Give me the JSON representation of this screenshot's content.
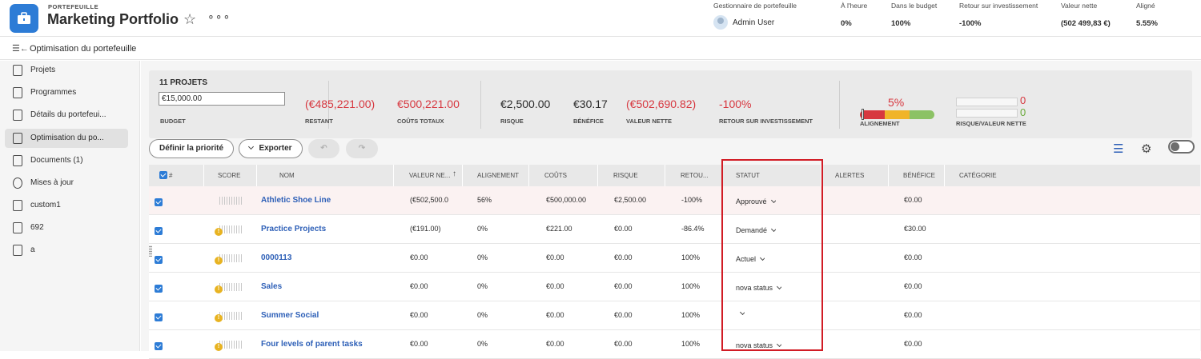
{
  "header": {
    "eyebrow": "PORTEFEUILLE",
    "title": "Marketing Portfolio",
    "stats": [
      {
        "label": "Gestionnaire de portefeuille",
        "value": "Admin User"
      },
      {
        "label": "À l'heure",
        "value": "0%"
      },
      {
        "label": "Dans le budget",
        "value": "100%"
      },
      {
        "label": "Retour sur investissement",
        "value": "-100%"
      },
      {
        "label": "Valeur nette",
        "value": "(502 499,83 €)"
      },
      {
        "label": "Aligné",
        "value": "5.55%"
      }
    ]
  },
  "breadcrumb": {
    "label": "Optimisation du portefeuille"
  },
  "sidebar": {
    "items": [
      {
        "label": "Projets",
        "icon": "list-icon"
      },
      {
        "label": "Programmes",
        "icon": "document-icon"
      },
      {
        "label": "Détails du portefeui...",
        "icon": "document-icon"
      },
      {
        "label": "Optimisation du po...",
        "icon": "calendar-gear-icon",
        "active": true
      },
      {
        "label": "Documents (1)",
        "icon": "document-icon"
      },
      {
        "label": "Mises à jour",
        "icon": "chat-icon"
      },
      {
        "label": "custom1",
        "icon": "custom-form-icon"
      },
      {
        "label": "692",
        "icon": "custom-form-icon"
      },
      {
        "label": "a",
        "icon": "custom-form-icon"
      }
    ]
  },
  "summary": {
    "projects_title": "11 PROJETS",
    "budget_value": "€15,000.00",
    "budget_label": "BUDGET",
    "metrics": [
      {
        "value": "(€485,221.00)",
        "label": "RESTANT",
        "color": "#d7373f"
      },
      {
        "value": "€500,221.00",
        "label": "COÛTS TOTAUX",
        "color": "#d7373f"
      },
      {
        "value": "€2,500.00",
        "label": "RISQUE",
        "color": "#2c2c2c"
      },
      {
        "value": "€30.17",
        "label": "BÉNÉFICE",
        "color": "#2c2c2c"
      },
      {
        "value": "(€502,690.82)",
        "label": "VALEUR NETTE",
        "color": "#d7373f"
      },
      {
        "value": "-100%",
        "label": "RETOUR SUR INVESTISSEMENT",
        "color": "#d7373f"
      }
    ],
    "alignment": {
      "value": "5%",
      "label": "ALIGNEMENT",
      "level": 0.05
    },
    "risk_net": {
      "top": "0",
      "bottom": "0",
      "label": "RISQUE/VALEUR NETTE"
    }
  },
  "toolbar": {
    "prioritize_label": "Définir la priorité",
    "export_label": "Exporter"
  },
  "table": {
    "columns": [
      "#",
      "SCORE",
      "NOM",
      "VALEUR NE...",
      "ALIGNEMENT",
      "COÛTS",
      "RISQUE",
      "RETOU...",
      "STATUT",
      "ALERTES",
      "BÉNÉFICE",
      "CATÉGORIE"
    ],
    "rows": [
      {
        "name": "Athletic Shoe Line",
        "net_value": "(€502,500.0",
        "alignment": "56%",
        "costs": "€500,000.00",
        "risk": "€2,500.00",
        "roi": "-100%",
        "status": "Approuvé",
        "benefit": "€0.00",
        "warning": false
      },
      {
        "name": "Practice Projects",
        "net_value": "(€191.00)",
        "alignment": "0%",
        "costs": "€221.00",
        "risk": "€0.00",
        "roi": "-86.4%",
        "status": "Demandé",
        "benefit": "€30.00",
        "warning": true
      },
      {
        "name": "0000113",
        "net_value": "€0.00",
        "alignment": "0%",
        "costs": "€0.00",
        "risk": "€0.00",
        "roi": "100%",
        "status": "Actuel",
        "benefit": "€0.00",
        "warning": true
      },
      {
        "name": "Sales",
        "net_value": "€0.00",
        "alignment": "0%",
        "costs": "€0.00",
        "risk": "€0.00",
        "roi": "100%",
        "status": "nova status",
        "benefit": "€0.00",
        "warning": true
      },
      {
        "name": "Summer Social",
        "net_value": "€0.00",
        "alignment": "0%",
        "costs": "€0.00",
        "risk": "€0.00",
        "roi": "100%",
        "status": "",
        "benefit": "€0.00",
        "warning": true
      },
      {
        "name": "Four levels of parent tasks",
        "net_value": "€0.00",
        "alignment": "0%",
        "costs": "€0.00",
        "risk": "€0.00",
        "roi": "100%",
        "status": "nova status",
        "benefit": "€0.00",
        "warning": true
      }
    ]
  }
}
